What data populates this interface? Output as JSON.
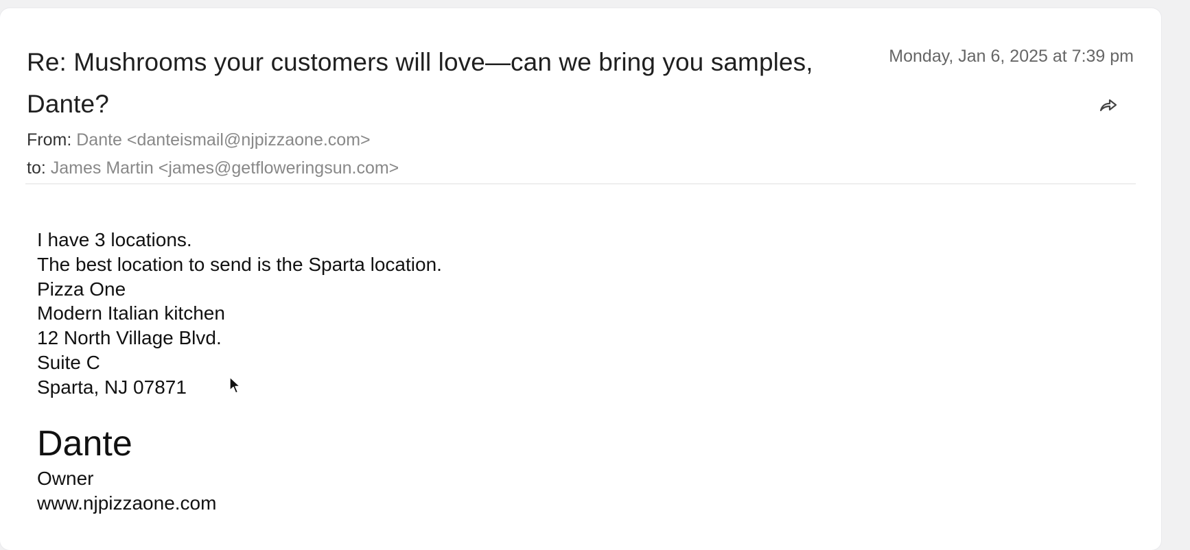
{
  "email": {
    "subject": "Re: Mushrooms your customers will love—can we bring you samples, Dante?",
    "date": "Monday, Jan 6, 2025 at 7:39 pm",
    "from_label": "From:",
    "from_value": "Dante <danteismail@njpizzaone.com>",
    "to_label": "to:",
    "to_value": "James Martin <james@getfloweringsun.com>",
    "body_lines": [
      "I have 3 locations.",
      "The best location to send is the Sparta location.",
      "Pizza One",
      "Modern Italian kitchen",
      "12 North Village Blvd.",
      "Suite C",
      "Sparta, NJ 07871"
    ],
    "signature": {
      "name": "Dante",
      "title": "Owner",
      "website": "www.njpizzaone.com"
    }
  },
  "icons": {
    "forward": "forward-arrow-icon",
    "cursor": "mouse-pointer-icon"
  },
  "colors": {
    "background": "#f1f1f2",
    "card": "#ffffff",
    "meta_text": "#888888",
    "body_text": "#111111"
  }
}
